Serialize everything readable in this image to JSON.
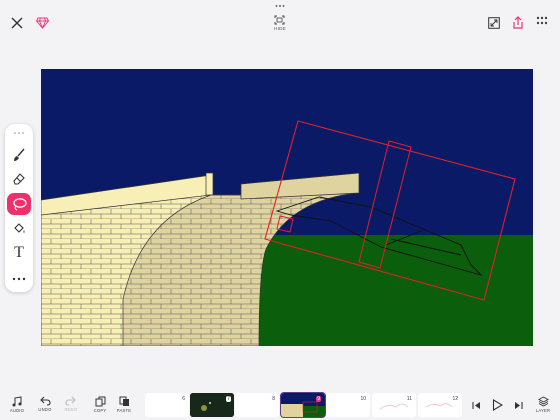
{
  "topbar": {
    "hide_label": "HIDE"
  },
  "toolbar": {
    "active_tool": "lasso",
    "text_tool_glyph": "T"
  },
  "bottombar": {
    "sound_label": "AUDIO",
    "undo_label": "UNDO",
    "redo_label": "REDO",
    "copy_label": "COPY",
    "paste_label": "PASTE",
    "layer_label": "LAYER"
  },
  "timeline": {
    "frames": [
      {
        "num": "6"
      },
      {
        "num": "7"
      },
      {
        "num": "8"
      },
      {
        "num": "9"
      },
      {
        "num": "10"
      },
      {
        "num": "11"
      },
      {
        "num": "12"
      }
    ],
    "current_frame": "9"
  },
  "colors": {
    "accent": "#e8337a",
    "sky": "#0a1a66",
    "grass": "#0b5e0b",
    "brick_light": "#f7efb5",
    "brick_mid": "#dfd3a0",
    "selection": "#e0202a"
  }
}
